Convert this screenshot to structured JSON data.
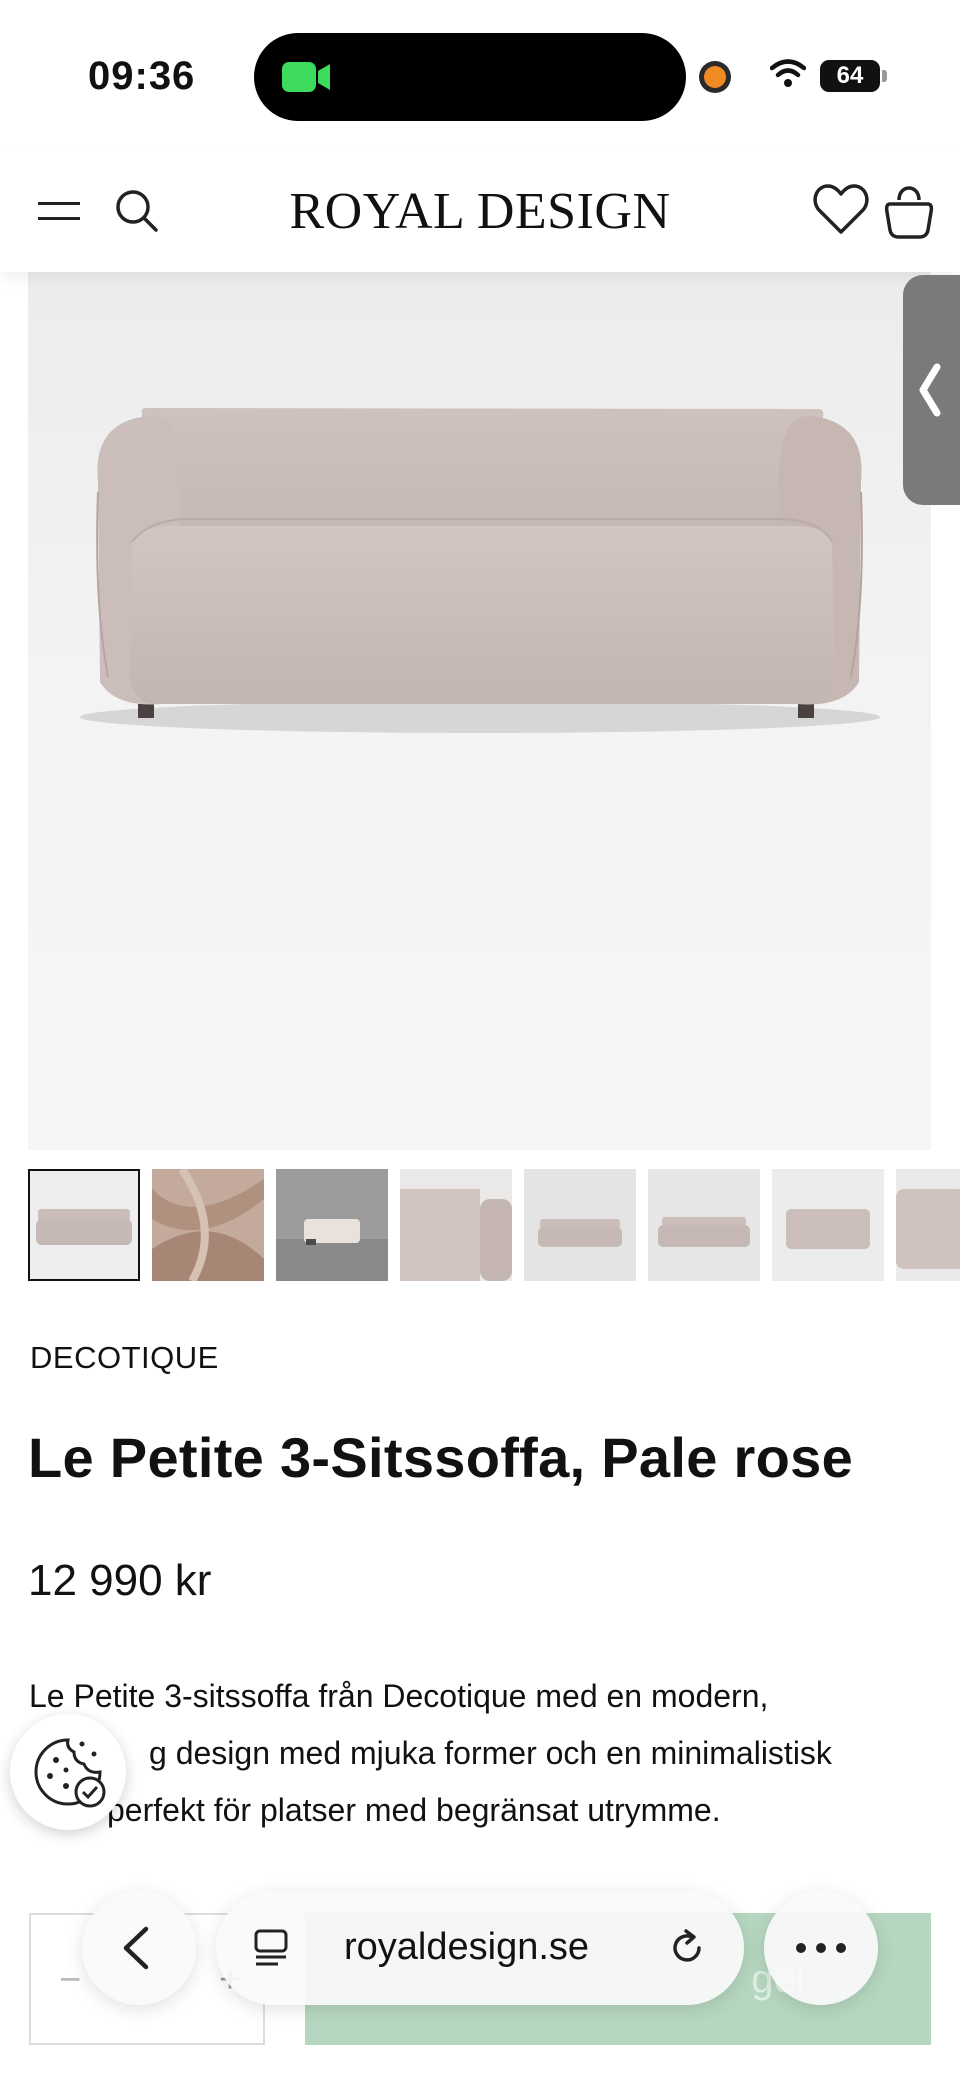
{
  "status_bar": {
    "time": "09:36",
    "battery": "64"
  },
  "header": {
    "logo": "ROYAL DESIGN"
  },
  "product": {
    "brand": "DECOTIQUE",
    "title": "Le Petite 3-Sitssoffa, Pale rose",
    "price": "12 990 kr",
    "description": "Le Petite 3-sitssoffa från Decotique med en modern, ...g design med mjuka former och en minimalistisk ... perfekt för platser med begränsat utrymme.",
    "desc_lines": [
      "Le Petite 3-sitssoffa från Decotique med en modern,",
      "g design med mjuka former och en minimalistisk",
      "perfekt för platser med begränsat utrymme."
    ]
  },
  "purchase": {
    "qty_minus": "−",
    "qty_plus": "+",
    "cart_label_partial": "gel"
  },
  "browser": {
    "url": "royaldesign.se"
  },
  "colors": {
    "sofa": "#c9bcb8",
    "accent_green": "#b6d7bf"
  },
  "thumbnails": [
    "sofa-front",
    "fabric-closeup",
    "sofa-room",
    "sofa-detail",
    "sofa-front-2",
    "sofa-angle",
    "sofa-back",
    "sofa-side"
  ]
}
